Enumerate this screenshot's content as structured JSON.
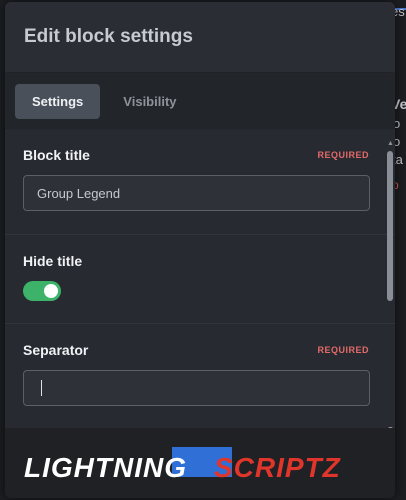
{
  "modal": {
    "title": "Edit block settings"
  },
  "tabs": [
    {
      "label": "Settings",
      "active": true
    },
    {
      "label": "Visibility",
      "active": false
    }
  ],
  "fields": {
    "block_title": {
      "label": "Block title",
      "required": "REQUIRED",
      "value": "Group Legend"
    },
    "hide_title": {
      "label": "Hide title",
      "toggle_on": true
    },
    "separator": {
      "label": "Separator",
      "required": "REQUIRED",
      "value": ""
    }
  },
  "background": {
    "text_1": "es",
    "text_2": "Ve",
    "text_3": "o",
    "text_4": "o",
    "text_5": "ta"
  },
  "watermark": {
    "text": "LIGHTNINGSCRIPTZ"
  },
  "colors": {
    "accent_toggle": "#3db36a",
    "required": "#e46a6a",
    "brand_blue": "#2f6fd6",
    "brand_red": "#e0352b"
  }
}
